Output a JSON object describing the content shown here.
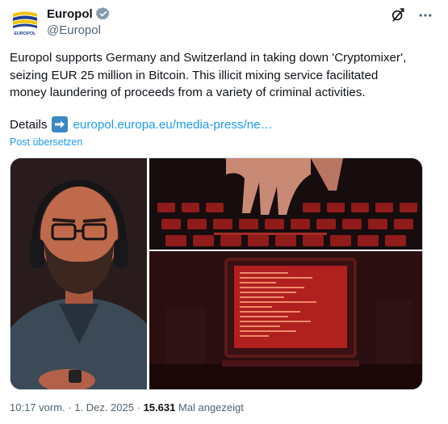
{
  "author": {
    "name": "Europol",
    "handle": "@Europol",
    "logo_text": "EUROPOL",
    "verified": true
  },
  "post": {
    "text": "Europol supports Germany and Switzerland in taking down 'Cryptomixer',\nseizing EUR 25 million in Bitcoin. This illicit mixing service facilitated\nmoney laundering of proceeds from a variety of criminal activities.",
    "details_label": "Details",
    "link_text": "europol.europa.eu/media-press/ne…",
    "translate_label": "Post übersetzen"
  },
  "media": {
    "images": [
      "man-with-headphones",
      "hands-on-keyboard",
      "red-computer-screen"
    ]
  },
  "meta": {
    "time": "10:17 vorm.",
    "separator": "·",
    "date": "1. Dez. 2025",
    "views": "15.631",
    "views_label": "Mal angezeigt"
  },
  "colors": {
    "link": "#1d9bf0",
    "secondary_text": "#536471",
    "verified_badge": "#829aab"
  },
  "icons": [
    "europol-logo",
    "verified-badge-icon",
    "grok-icon",
    "more-icon",
    "arrow-right-emoji-icon"
  ]
}
